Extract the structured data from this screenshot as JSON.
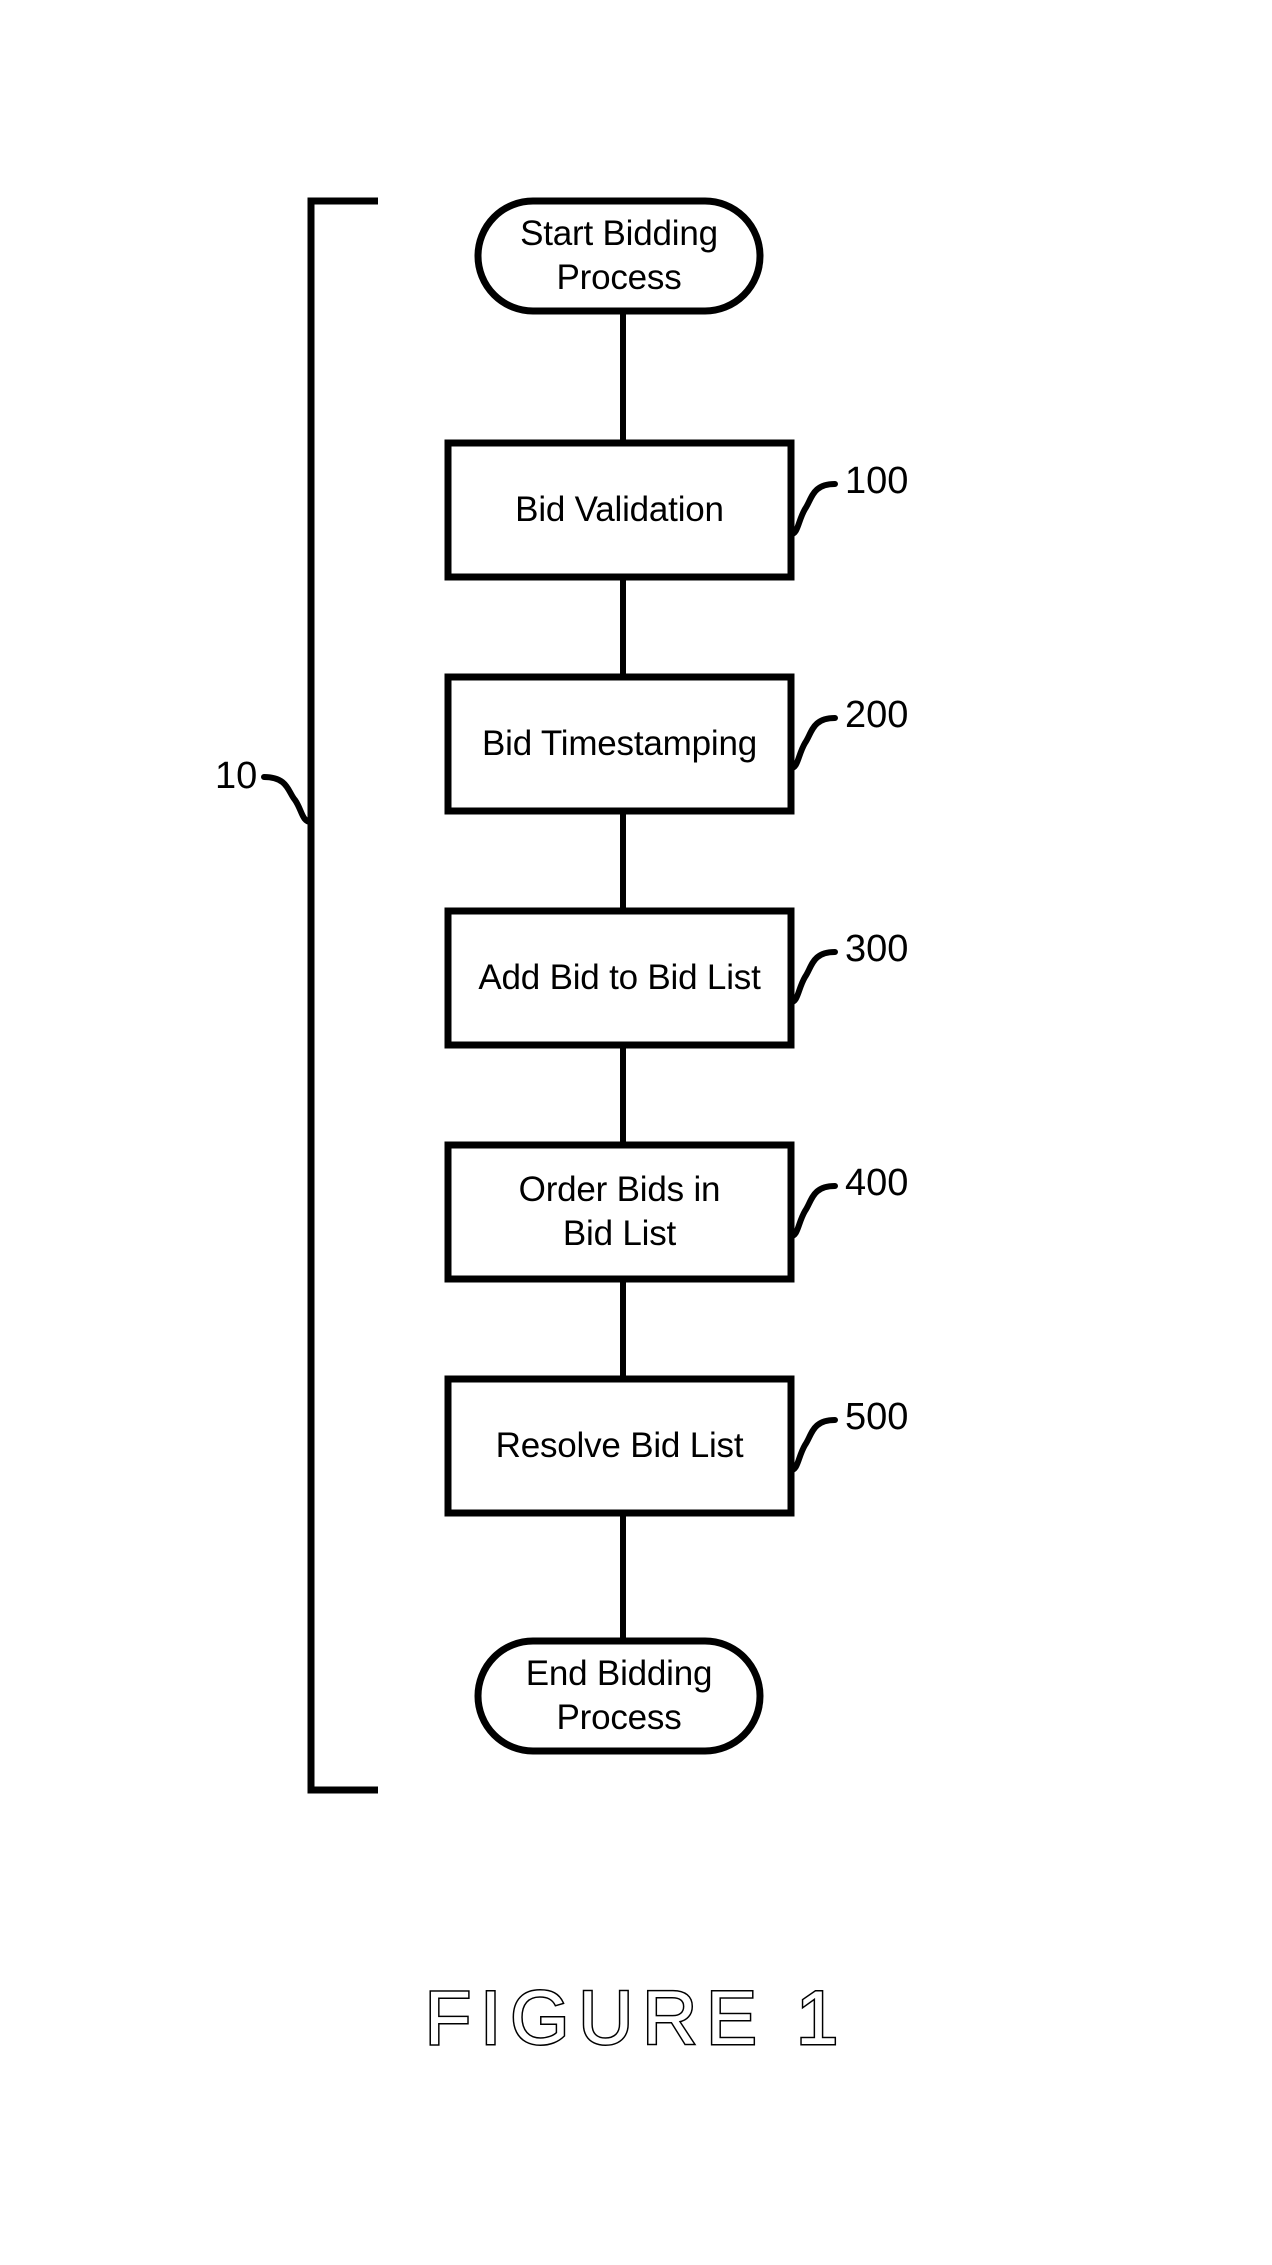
{
  "figure": {
    "caption": "FIGURE 1",
    "system_ref": "10",
    "line_color": "#000000",
    "background_color": "#ffffff",
    "text_color": "#000000"
  },
  "flowchart": {
    "type": "flowchart",
    "orientation": "vertical",
    "nodes": [
      {
        "id": "start",
        "shape": "terminator",
        "label": "Start Bidding\nProcess",
        "ref": ""
      },
      {
        "id": "validation",
        "shape": "process",
        "label": "Bid Validation",
        "ref": "100"
      },
      {
        "id": "timestamp",
        "shape": "process",
        "label": "Bid Timestamping",
        "ref": "200"
      },
      {
        "id": "addbid",
        "shape": "process",
        "label": "Add Bid to Bid List",
        "ref": "300"
      },
      {
        "id": "orderbids",
        "shape": "process",
        "label": "Order Bids in\nBid List",
        "ref": "400"
      },
      {
        "id": "resolve",
        "shape": "process",
        "label": "Resolve Bid List",
        "ref": "500"
      },
      {
        "id": "end",
        "shape": "terminator",
        "label": "End Bidding\nProcess",
        "ref": ""
      }
    ],
    "edges": [
      {
        "from": "start",
        "to": "validation"
      },
      {
        "from": "validation",
        "to": "timestamp"
      },
      {
        "from": "timestamp",
        "to": "addbid"
      },
      {
        "from": "addbid",
        "to": "orderbids"
      },
      {
        "from": "orderbids",
        "to": "resolve"
      },
      {
        "from": "resolve",
        "to": "end"
      }
    ],
    "ref_numerals": [
      "100",
      "200",
      "300",
      "400",
      "500"
    ],
    "bracket_label": "10"
  }
}
